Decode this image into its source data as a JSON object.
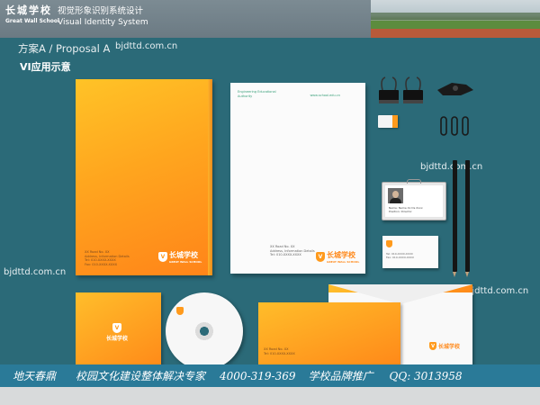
{
  "header": {
    "brand_zh": "长城学校",
    "brand_en": "Great Wall School",
    "title_zh": "视觉形象识别系统设计",
    "title_en": "Visual Identity System"
  },
  "proposal": "方案A / Proposal A",
  "section_title": "VI应用示意",
  "watermark": "bjdttd.com.cn",
  "logo": {
    "text": "长城学校",
    "sub": "GREAT WALL SCHOOL"
  },
  "folder_address": [
    "XX Road No. XX",
    "Address, Information Details",
    "Tel: 010-XXXX-XXXX",
    "Fax: 010-XXXX-XXXX"
  ],
  "letterhead_left": [
    "Engineering Educational",
    "Authority"
  ],
  "letterhead_right": "www.school.edu.cn",
  "id_card_info": [
    "Name: Name Xx Ds Xxxx",
    "Position: Director"
  ],
  "footer": {
    "company": "地天春鼎",
    "slogan": "校园文化建设整体解决专家",
    "phone": "4000-319-369",
    "service": "学校品牌推广",
    "qq": "QQ: 3013958"
  },
  "colors": {
    "accent": "#ff9a1c",
    "background": "#2b6a78",
    "footer": "#2a7a98"
  }
}
